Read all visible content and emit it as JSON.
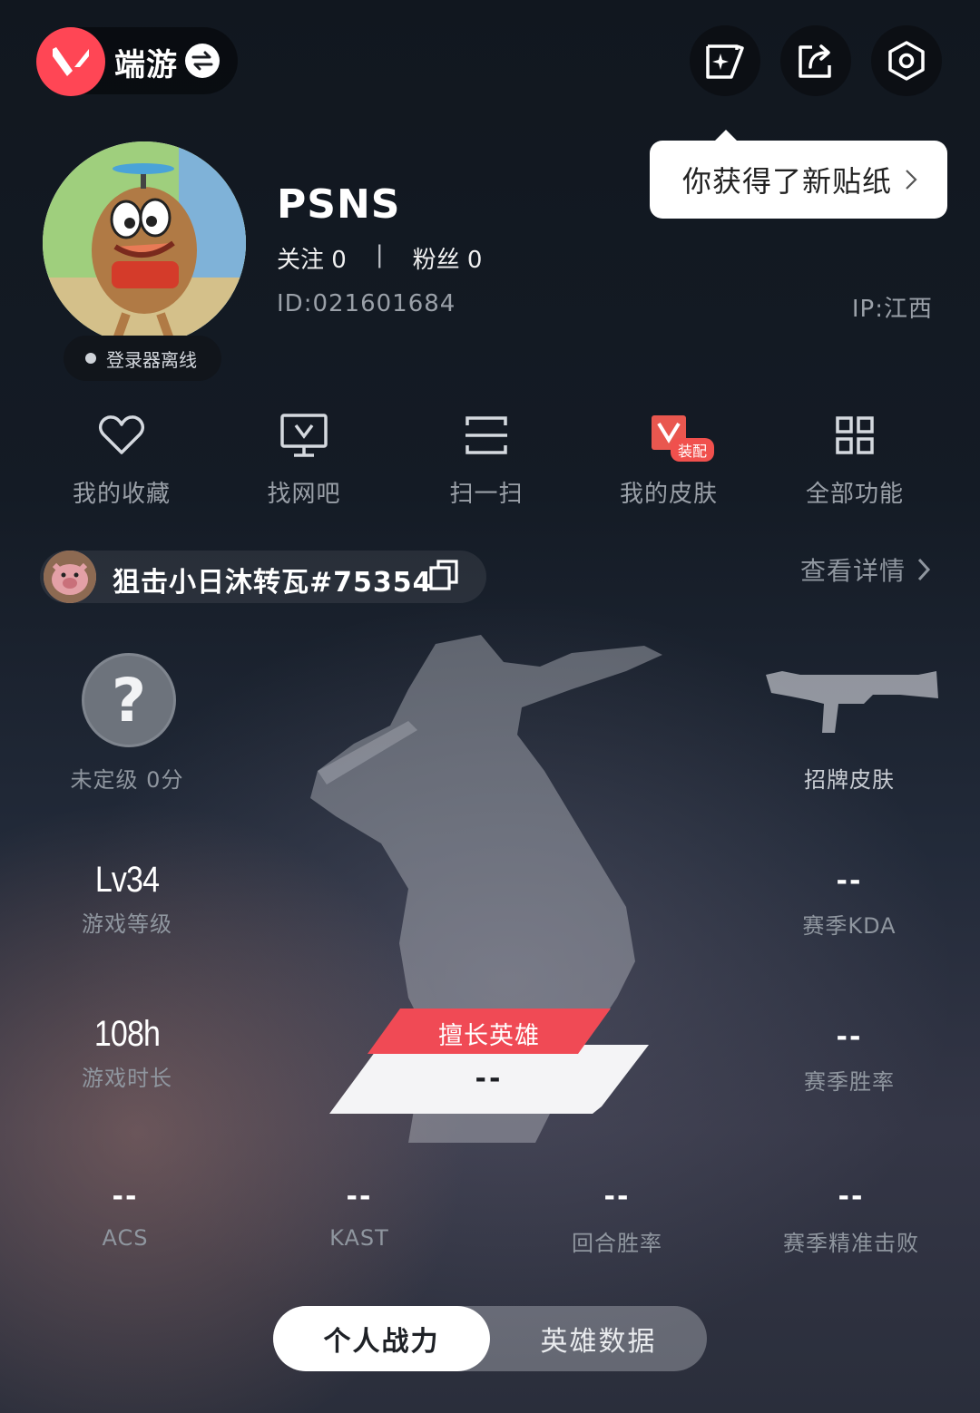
{
  "header": {
    "game_name": "端游",
    "logo": "valorant-logo",
    "buttons": [
      "sticker-icon",
      "share-icon",
      "settings-icon"
    ]
  },
  "tooltip": {
    "text": "你获得了新贴纸"
  },
  "profile": {
    "status": "登录器离线",
    "username": "PSNS",
    "following_label": "关注",
    "following_count": "0",
    "separator": "|",
    "fans_label": "粉丝",
    "fans_count": "0",
    "id": "ID:021601684",
    "ip": "IP:江西"
  },
  "actions": [
    {
      "label": "我的收藏",
      "icon": "heart-icon"
    },
    {
      "label": "找网吧",
      "icon": "monitor-icon"
    },
    {
      "label": "扫一扫",
      "icon": "scan-icon"
    },
    {
      "label": "我的皮肤",
      "icon": "skin-icon",
      "badge": "装配"
    },
    {
      "label": "全部功能",
      "icon": "grid-icon"
    }
  ],
  "riot": {
    "id": "狙击小日沐转瓦#75354",
    "view_details": "查看详情"
  },
  "stats": {
    "rank": {
      "icon_text": "?",
      "label": "未定级 0分"
    },
    "signature_skin": {
      "label": "招牌皮肤"
    },
    "level": {
      "value": "Lv34",
      "label": "游戏等级"
    },
    "season_kda": {
      "value": "--",
      "label": "赛季KDA"
    },
    "playtime": {
      "value": "108h",
      "label": "游戏时长"
    },
    "season_winrate": {
      "value": "--",
      "label": "赛季胜率"
    },
    "best_hero": {
      "tag": "擅长英雄",
      "value": "--"
    },
    "acs": {
      "value": "--",
      "label": "ACS"
    },
    "kast": {
      "value": "--",
      "label": "KAST"
    },
    "round_winrate": {
      "value": "--",
      "label": "回合胜率"
    },
    "season_headshot": {
      "value": "--",
      "label": "赛季精准击败"
    }
  },
  "tabs": [
    {
      "label": "个人战力",
      "active": true
    },
    {
      "label": "英雄数据",
      "active": false
    }
  ],
  "colors": {
    "accent": "#ff4655",
    "badge": "#f0504d",
    "muted": "#8f969f"
  }
}
